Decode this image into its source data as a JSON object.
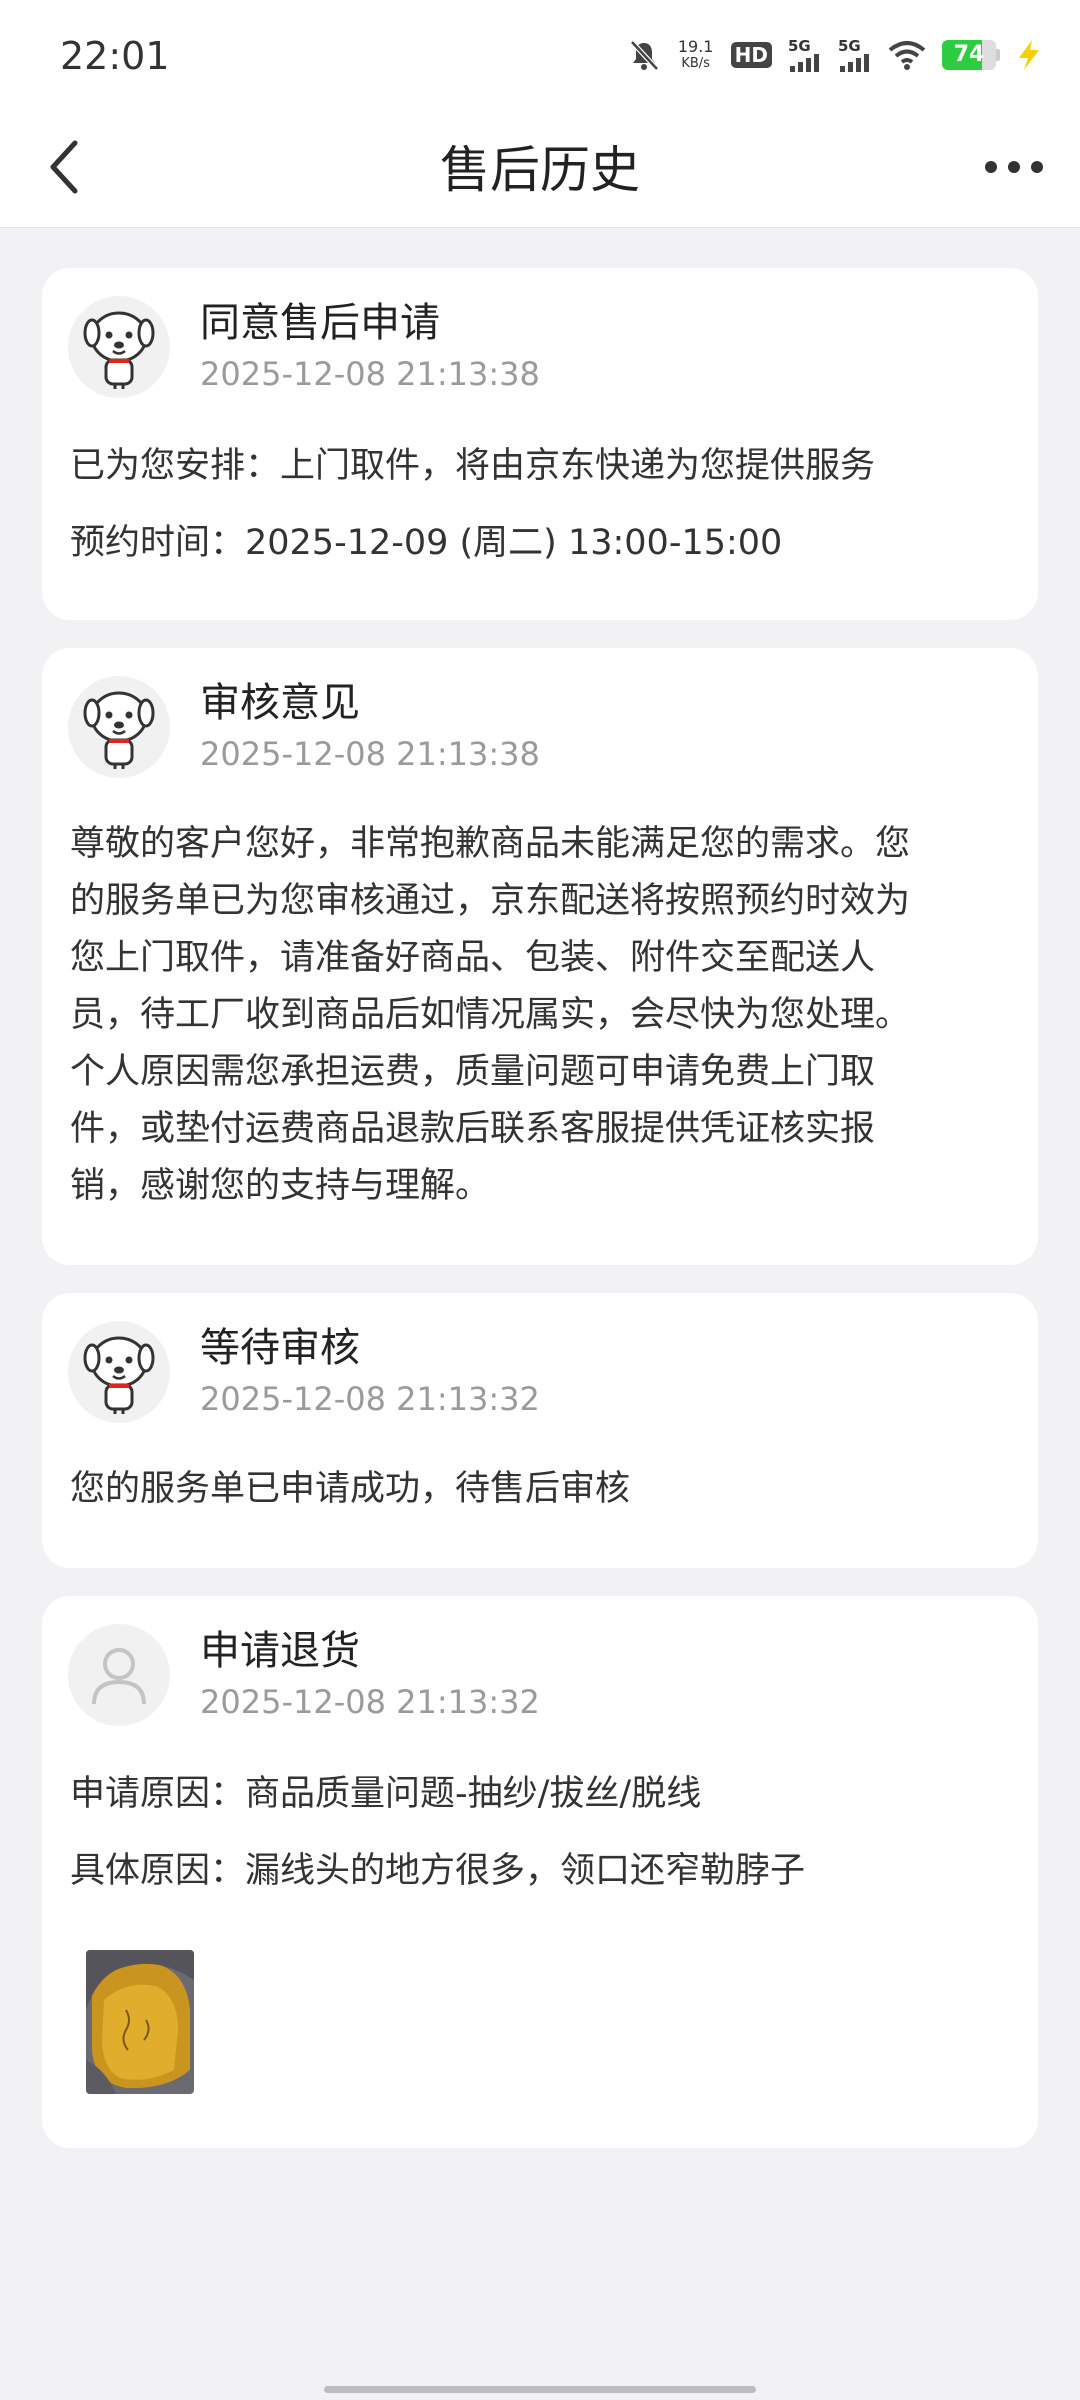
{
  "status_bar": {
    "time": "22:01",
    "net_speed_value": "19.1",
    "net_speed_unit": "KB/s",
    "hd_label": "HD",
    "sim1_label": "5G",
    "sim2_label": "5G",
    "battery_level": "74",
    "battery_fraction": 0.74,
    "charging_color": "#f5d000",
    "battery_color": "#2ecc40",
    "icons": [
      "mute-bell-icon",
      "hd-icon",
      "signal-icon",
      "wifi-icon",
      "battery-icon",
      "charging-bolt-icon"
    ]
  },
  "nav": {
    "title": "售后历史",
    "back_icon": "chevron-left-icon",
    "more_icon": "more-dots-icon"
  },
  "records": [
    {
      "title": "同意售后申请",
      "time": "2025-12-08 21:13:38",
      "avatar": "jd-mascot-avatar",
      "lines": [
        "已为您安排：上门取件，将由京东快递为您提供服务",
        "预约时间：2025-12-09 (周二) 13:00-15:00"
      ]
    },
    {
      "title": "审核意见",
      "time": "2025-12-08 21:13:38",
      "avatar": "jd-mascot-avatar",
      "paragraph_lines": [
        "尊敬的客户您好，非常抱歉商品未能满足您的需求。您",
        "的服务单已为您审核通过，京东配送将按照预约时效为",
        "您上门取件，请准备好商品、包装、附件交至配送人",
        "员，待工厂收到商品后如情况属实，会尽快为您处理。",
        "个人原因需您承担运费，质量问题可申请免费上门取",
        "件，或垫付运费商品退款后联系客服提供凭证核实报",
        "销，感谢您的支持与理解。"
      ]
    },
    {
      "title": "等待审核",
      "time": "2025-12-08 21:13:32",
      "avatar": "jd-mascot-avatar",
      "lines": [
        "您的服务单已申请成功，待售后审核"
      ]
    },
    {
      "title": "申请退货",
      "time": "2025-12-08 21:13:32",
      "avatar": "user-placeholder-avatar",
      "lines": [
        "申请原因：商品质量问题-抽纱/拔丝/脱线",
        "具体原因：漏线头的地方很多，领口还窄勒脖子"
      ],
      "attachment": "product-photo-thumbnail"
    }
  ]
}
